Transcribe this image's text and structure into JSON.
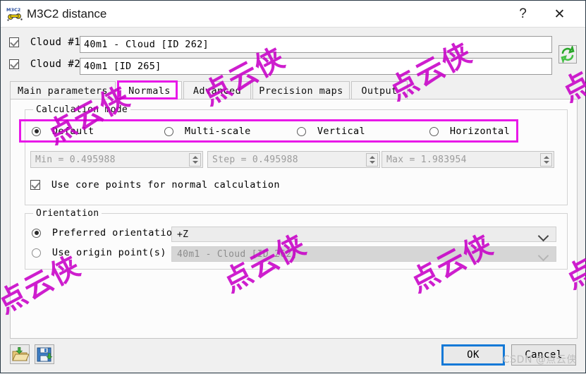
{
  "window": {
    "title": "M3C2 distance",
    "icon": "m3c2-app-icon",
    "help_label": "?",
    "close_label": "✕"
  },
  "clouds": [
    {
      "checkbox_label": "Cloud #1",
      "checked": true,
      "value": "40m1 - Cloud [ID 262]"
    },
    {
      "checkbox_label": "Cloud #2",
      "checked": true,
      "value": "40m1 [ID 265]"
    }
  ],
  "swap_button": {
    "name": "swap-clouds-button",
    "icon": "refresh-swap-icon"
  },
  "tabs": [
    {
      "label": "Main parameters",
      "selected": false
    },
    {
      "label": "Normals",
      "selected": true
    },
    {
      "label": "Advanced",
      "selected": false
    },
    {
      "label": "Precision maps",
      "selected": false
    },
    {
      "label": "Output",
      "selected": false
    }
  ],
  "calculation_mode": {
    "group_title": "Calculation mode",
    "options": [
      {
        "label": "Default",
        "selected": true
      },
      {
        "label": "Multi-scale",
        "selected": false
      },
      {
        "label": "Vertical",
        "selected": false
      },
      {
        "label": "Horizontal",
        "selected": false
      }
    ],
    "spinboxes": [
      {
        "name": "min-scale-spinbox",
        "value": "Min = 0.495988",
        "enabled": false
      },
      {
        "name": "step-scale-spinbox",
        "value": "Step = 0.495988",
        "enabled": false
      },
      {
        "name": "max-scale-spinbox",
        "value": "Max = 1.983954",
        "enabled": false
      }
    ],
    "core_points_checkbox": {
      "label": "Use core points for normal calculation",
      "checked": true
    }
  },
  "orientation": {
    "group_title": "Orientation",
    "options": [
      {
        "label": "Preferred orientation",
        "selected": true
      },
      {
        "label": "Use origin point(s)",
        "selected": false
      }
    ],
    "preferred_value": "+Z",
    "origin_value": "40m1 - Cloud [ID 262]"
  },
  "footer": {
    "load_button": {
      "name": "load-parameters-button",
      "icon": "folder-open-icon"
    },
    "save_button": {
      "name": "save-parameters-button",
      "icon": "floppy-save-icon"
    },
    "ok_label": "OK",
    "cancel_label": "Cancel"
  },
  "annotations": {
    "accent_color": "#e818e8",
    "highlighted_tab": "Normals",
    "highlighted_group": "calculation mode radio row"
  },
  "watermark": {
    "text": "点云侠",
    "color": "#c800c8",
    "corner_text": "CSDN @点云侠"
  }
}
